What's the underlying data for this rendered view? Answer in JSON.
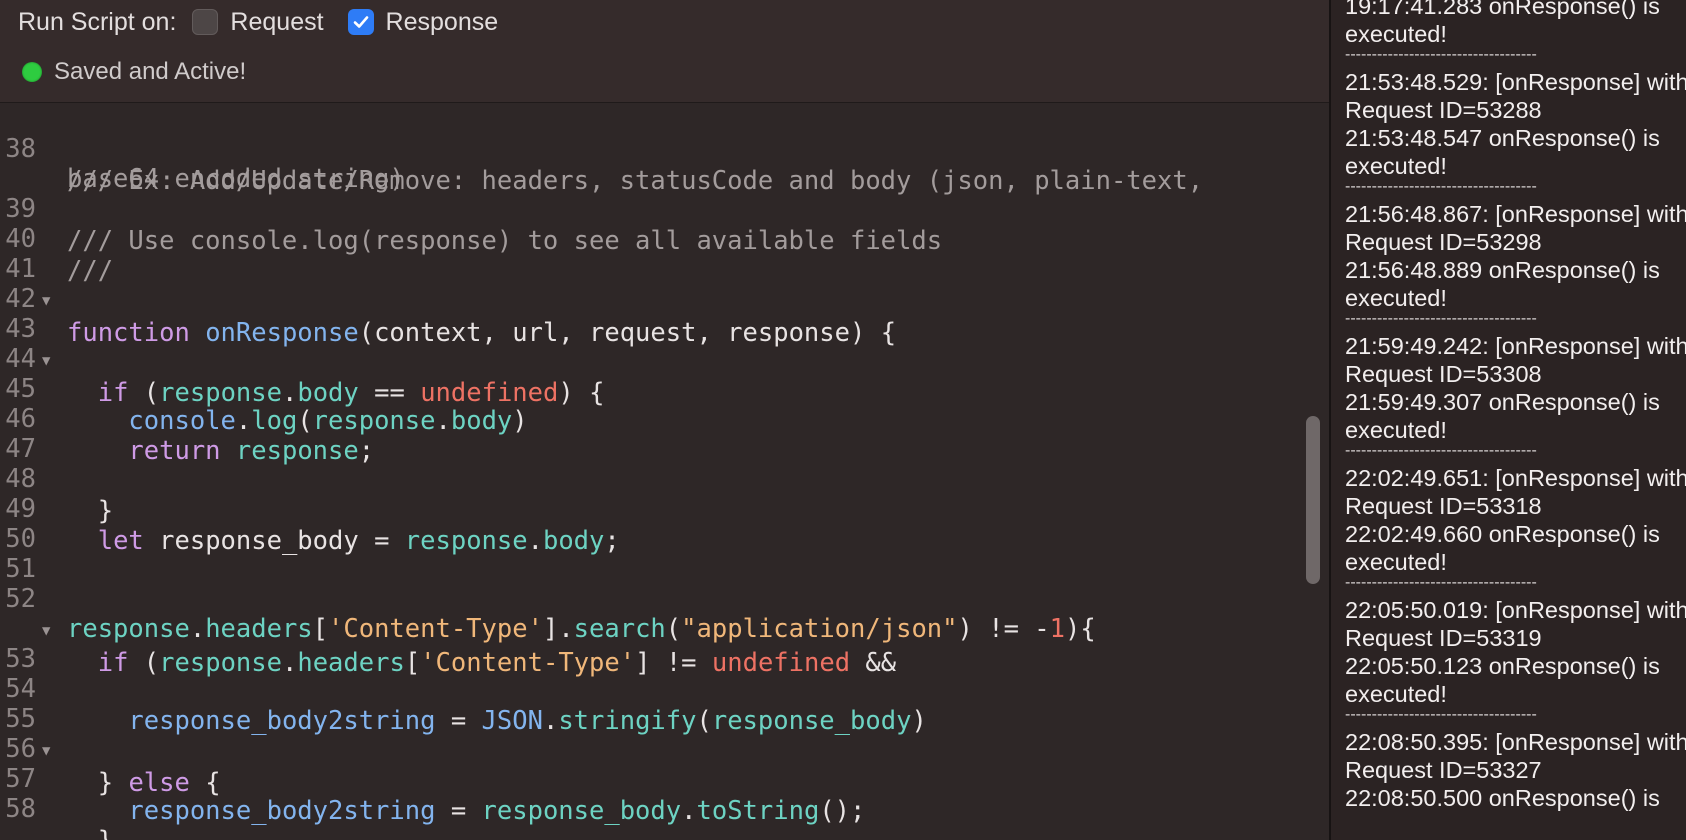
{
  "toolbar": {
    "run_label": "Run Script on:",
    "request_label": "Request",
    "request_checked": false,
    "response_label": "Response",
    "response_checked": true,
    "status_text": "Saved and Active!",
    "status_color": "#2ecc40"
  },
  "editor": {
    "lines": {
      "l38a": {
        "num": "38",
        "text": "/// Ex: Add/Update/Remove: headers, statusCode and body (json, plain-text,"
      },
      "l38b": {
        "text": "base64 encoded string)"
      },
      "l39": {
        "num": "39",
        "text": "/// Use console.log(response) to see all available fields"
      },
      "l40": {
        "num": "40",
        "text": "///"
      },
      "l41": {
        "num": "41"
      },
      "l42": {
        "num": "42"
      },
      "l43": {
        "num": "43"
      },
      "l44": {
        "num": "44"
      },
      "l45": {
        "num": "45"
      },
      "l46": {
        "num": "46"
      },
      "l47": {
        "num": "47"
      },
      "l48": {
        "num": "48"
      },
      "l49": {
        "num": "49"
      },
      "l50": {
        "num": "50"
      },
      "l51": {
        "num": "51"
      },
      "l52": {
        "num": "52"
      },
      "l53": {
        "num": "53"
      },
      "l54": {
        "num": "54"
      },
      "l55": {
        "num": "55"
      },
      "l56": {
        "num": "56"
      },
      "l57": {
        "num": "57"
      },
      "l58": {
        "num": "58"
      }
    },
    "tokens": {
      "function": "function",
      "onResponse": "onResponse",
      "params": "(context, url, request, response) {",
      "if": "if",
      "open_paren": " (",
      "response": "response",
      "dot": ".",
      "body": "body",
      "eqeq": " == ",
      "undefined": "undefined",
      "close_brace_open": ") {",
      "console": "console",
      "log": "log",
      "lparen": "(",
      "rparen": ")",
      "return": "return",
      "semicolon": ";",
      "close_brace": "}",
      "let": "let",
      "response_body_assign": " response_body = ",
      "headers": "headers",
      "lbracket": "[",
      "content_type": "'Content-Type'",
      "rbracket": "]",
      "neq": " != ",
      "and": " &&",
      "search": "search",
      "app_json": "\"application/json\"",
      "neg_one_a": " != -",
      "one": "1",
      "close_brace_open2": "){",
      "response_body2string": "response_body2string",
      "assign": " = ",
      "JSON": "JSON",
      "stringify": "stringify",
      "response_body": "response_body",
      "else_brace_close": "} ",
      "else": "else",
      "open_brace": " {",
      "toString": "toString",
      "call_end": "();"
    }
  },
  "log": {
    "entries": [
      "19:17:41.283 onResponse() is",
      "executed!",
      "------------------------------------",
      "21:53:48.529: [onResponse] with",
      "Request ID=53288",
      "21:53:48.547 onResponse() is",
      "executed!",
      "------------------------------------",
      "21:56:48.867: [onResponse] with",
      "Request ID=53298",
      "21:56:48.889 onResponse() is",
      "executed!",
      "------------------------------------",
      "21:59:49.242: [onResponse] with",
      "Request ID=53308",
      "21:59:49.307 onResponse() is",
      "executed!",
      "------------------------------------",
      "22:02:49.651: [onResponse] with",
      "Request ID=53318",
      "22:02:49.660 onResponse() is",
      "executed!",
      "------------------------------------",
      "22:05:50.019: [onResponse] with",
      "Request ID=53319",
      "22:05:50.123 onResponse() is",
      "executed!",
      "------------------------------------",
      "22:08:50.395: [onResponse] with",
      "Request ID=53327",
      "22:08:50.500 onResponse() is"
    ]
  },
  "colors": {
    "accent": "#2e7cf6",
    "keyword": "#cf9be6",
    "function": "#83b4ee",
    "property": "#6dd3c3",
    "undefined": "#ee7264",
    "string": "#f0b77a",
    "comment": "#a39c9c"
  },
  "icons": {
    "fold": "fold-triangle-icon",
    "check": "checkmark-icon"
  }
}
